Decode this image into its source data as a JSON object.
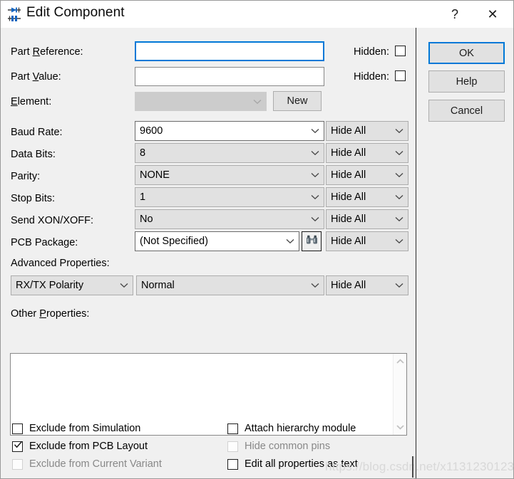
{
  "window": {
    "title": "Edit Component",
    "icon": "component-icon",
    "help_glyph": "?",
    "close_glyph": "✕"
  },
  "fields": {
    "part_reference": {
      "label_pre": "Part ",
      "label_mnemonic": "R",
      "label_post": "eference:",
      "value": "",
      "hidden_label": "Hidden:",
      "hidden_checked": false
    },
    "part_value": {
      "label_pre": "Part ",
      "label_mnemonic": "V",
      "label_post": "alue:",
      "value": "",
      "hidden_label": "Hidden:",
      "hidden_checked": false
    },
    "element": {
      "label_mnemonic": "E",
      "label_post": "lement:",
      "value": "",
      "disabled": true,
      "new_button": "New"
    }
  },
  "properties": [
    {
      "label": "Baud Rate:",
      "value": "9600",
      "visibility": "Hide All",
      "editable": true
    },
    {
      "label": "Data Bits:",
      "value": "8",
      "visibility": "Hide All",
      "editable": false
    },
    {
      "label": "Parity:",
      "value": "NONE",
      "visibility": "Hide All",
      "editable": false
    },
    {
      "label": "Stop Bits:",
      "value": "1",
      "visibility": "Hide All",
      "editable": false
    },
    {
      "label": "Send XON/XOFF:",
      "value": "No",
      "visibility": "Hide All",
      "editable": false
    },
    {
      "label": "PCB Package:",
      "value": "(Not Specified)",
      "visibility": "Hide All",
      "editable": true,
      "browse_icon": "binoculars-icon"
    }
  ],
  "advanced": {
    "label": "Advanced Properties:",
    "property": "RX/TX Polarity",
    "value": "Normal",
    "visibility": "Hide All"
  },
  "other_properties": {
    "label_pre": "Other ",
    "label_mnemonic": "P",
    "label_post": "roperties:",
    "value": ""
  },
  "checkboxes": {
    "left": [
      {
        "label": "Exclude from Simulation",
        "checked": false,
        "disabled": false
      },
      {
        "label": "Exclude from PCB Layout",
        "checked": true,
        "disabled": false
      },
      {
        "label": "Exclude from Current Variant",
        "checked": false,
        "disabled": true
      }
    ],
    "right": [
      {
        "label": "Attach hierarchy module",
        "checked": false,
        "disabled": false
      },
      {
        "label": "Hide common pins",
        "checked": false,
        "disabled": true
      },
      {
        "label": "Edit all properties as text",
        "checked": false,
        "disabled": false
      }
    ]
  },
  "buttons": {
    "ok": "OK",
    "help": "Help",
    "cancel": "Cancel"
  },
  "watermark": "https://blog.csdn.net/x1131230123",
  "colors": {
    "dialog_background": "#f0f0f0",
    "accent_focus": "#0078d7",
    "combo_disabled": "#cccccc",
    "title_background": "#ffffff"
  }
}
